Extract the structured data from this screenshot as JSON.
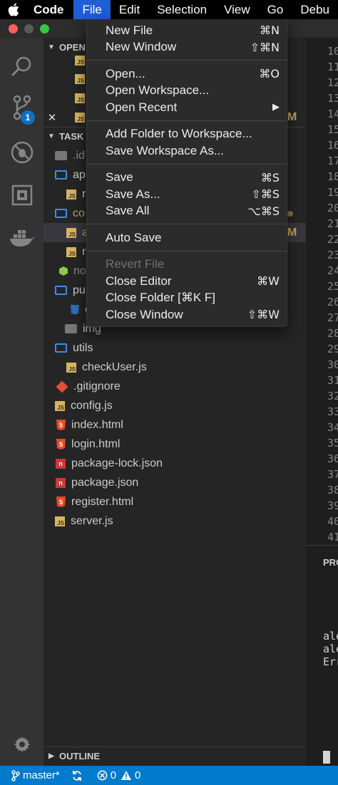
{
  "menubar": {
    "app_name": "Code",
    "items": [
      "File",
      "Edit",
      "Selection",
      "View",
      "Go",
      "Debu"
    ],
    "active": "File"
  },
  "file_menu": {
    "groups": [
      [
        {
          "label": "New File",
          "shortcut": "⌘N"
        },
        {
          "label": "New Window",
          "shortcut": "⇧⌘N"
        }
      ],
      [
        {
          "label": "Open...",
          "shortcut": "⌘O"
        },
        {
          "label": "Open Workspace...",
          "shortcut": ""
        },
        {
          "label": "Open Recent",
          "shortcut": "▶"
        }
      ],
      [
        {
          "label": "Add Folder to Workspace...",
          "shortcut": ""
        },
        {
          "label": "Save Workspace As...",
          "shortcut": ""
        }
      ],
      [
        {
          "label": "Save",
          "shortcut": "⌘S"
        },
        {
          "label": "Save As...",
          "shortcut": "⇧⌘S"
        },
        {
          "label": "Save All",
          "shortcut": "⌥⌘S"
        }
      ],
      [
        {
          "label": "Auto Save",
          "shortcut": ""
        }
      ],
      [
        {
          "label": "Revert File",
          "shortcut": "",
          "disabled": true
        },
        {
          "label": "Close Editor",
          "shortcut": "⌘W"
        },
        {
          "label": "Close Folder [⌘K F]",
          "shortcut": ""
        },
        {
          "label": "Close Window",
          "shortcut": "⇧⌘W"
        }
      ]
    ]
  },
  "activity_bar": {
    "source_control_badge": "1"
  },
  "sidebar": {
    "open_editors_header": "OPEN",
    "open_editors": [
      {
        "icon": "js"
      },
      {
        "icon": "js"
      },
      {
        "icon": "js"
      },
      {
        "icon": "js",
        "close": "✕",
        "status": "M"
      }
    ],
    "folder_header": "TASK",
    "tree": [
      {
        "name": ".id",
        "icon": "folder-gray",
        "indent": 0
      },
      {
        "name": "ap",
        "icon": "folder",
        "indent": 0
      },
      {
        "name": "r",
        "icon": "js",
        "indent": 1
      },
      {
        "name": "co",
        "icon": "folder",
        "indent": 0,
        "status_dot": true
      },
      {
        "name": "a",
        "icon": "js",
        "indent": 1,
        "selected": true,
        "status": "M"
      },
      {
        "name": "r",
        "icon": "js",
        "indent": 1
      },
      {
        "name": "no",
        "icon": "node",
        "indent": 0
      },
      {
        "name": "pu",
        "icon": "folder",
        "indent": 0
      },
      {
        "name": "c",
        "icon": "css",
        "indent": 1
      },
      {
        "name": "img",
        "icon": "img",
        "indent": 1
      },
      {
        "name": "utils",
        "icon": "folder",
        "indent": 0
      },
      {
        "name": "checkUser.js",
        "icon": "js",
        "indent": 1
      },
      {
        "name": ".gitignore",
        "icon": "git",
        "indent": 0
      },
      {
        "name": "config.js",
        "icon": "js",
        "indent": 0
      },
      {
        "name": "index.html",
        "icon": "html",
        "indent": 0
      },
      {
        "name": "login.html",
        "icon": "html",
        "indent": 0
      },
      {
        "name": "package-lock.json",
        "icon": "npm-lock",
        "indent": 0
      },
      {
        "name": "package.json",
        "icon": "npm",
        "indent": 0
      },
      {
        "name": "register.html",
        "icon": "html",
        "indent": 0
      },
      {
        "name": "server.js",
        "icon": "js",
        "indent": 0
      }
    ],
    "outline_header": "OUTLINE"
  },
  "editor": {
    "line_numbers": [
      "10",
      "11",
      "12",
      "13",
      "14",
      "15",
      "16",
      "17",
      "18",
      "19",
      "20",
      "21",
      "22",
      "23",
      "24",
      "25",
      "26",
      "27",
      "28",
      "29",
      "30",
      "31",
      "32",
      "33",
      "34",
      "35",
      "36",
      "37",
      "38",
      "39",
      "40",
      "41"
    ]
  },
  "panel": {
    "title": "PRO",
    "lines": [
      "ale",
      "ale",
      "Err"
    ]
  },
  "statusbar": {
    "branch": "master*",
    "errors": "0",
    "warnings": "0"
  }
}
